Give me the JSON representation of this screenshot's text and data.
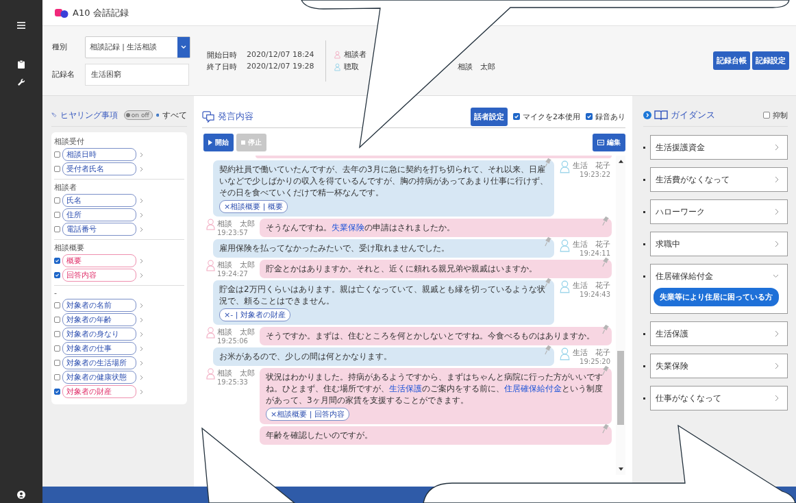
{
  "window": {
    "title": "A10 会話記録"
  },
  "record": {
    "type_label": "種別",
    "type_value": "相談記録 | 生活相談",
    "name_label": "記録名",
    "name_value": "生活困窮"
  },
  "times": [
    {
      "label": "開始日時",
      "value": "2020/12/07 18:24"
    },
    {
      "label": "終了日時",
      "value": "2020/12/07 19:28"
    }
  ],
  "participants": [
    {
      "role": "相談者",
      "kind": "staff"
    },
    {
      "role": "聴取",
      "kind": "client"
    }
  ],
  "participant_name": "相談　太郎",
  "header_buttons": [
    "記録台帳",
    "記録設定"
  ],
  "hearing": {
    "title": "ヒヤリング事項",
    "toggle": {
      "label": "on off",
      "on": false
    },
    "all_label": "すべて",
    "groups": [
      {
        "title": "相談受付",
        "items": [
          {
            "label": "相談日時",
            "checked": false
          },
          {
            "label": "受付者氏名",
            "checked": false
          }
        ]
      },
      {
        "title": "相談者",
        "items": [
          {
            "label": "氏名",
            "checked": false
          },
          {
            "label": "住所",
            "checked": false
          },
          {
            "label": "電話番号",
            "checked": false
          }
        ]
      },
      {
        "title": "相談概要",
        "items": [
          {
            "label": "概要",
            "checked": true
          },
          {
            "label": "回答内容",
            "checked": true
          }
        ]
      },
      {
        "title": "-",
        "items": [
          {
            "label": "対象者の名前",
            "checked": false
          },
          {
            "label": "対象者の年齢",
            "checked": false
          },
          {
            "label": "対象者の身なり",
            "checked": false
          },
          {
            "label": "対象者の仕事",
            "checked": false
          },
          {
            "label": "対象者の生活場所",
            "checked": false
          },
          {
            "label": "対象者の健康状態",
            "checked": false
          },
          {
            "label": "対象者の財産",
            "checked": true
          }
        ]
      }
    ]
  },
  "conversation": {
    "title": "発言内容",
    "speaker_button": "話者設定",
    "options": [
      {
        "label": "マイクを2本使用",
        "checked": true
      },
      {
        "label": "録音あり",
        "checked": true
      }
    ],
    "start": {
      "label": "開始",
      "disabled": false
    },
    "stop": {
      "label": "停止",
      "disabled": true
    },
    "edit": "編集",
    "messages": [
      {
        "kind": "client",
        "name": "生活　花子",
        "time": "19:23:22",
        "segments": [
          {
            "text": "契約社員で働いていたんですが、去年の3月に急に契約を打ち切られて、それ以来、日雇いなどで少しばかりの収入を得ているんですが、胸の持病があってあまり仕事に行けず、その日を食べていくだけで精一杯なんです。",
            "link": false
          }
        ],
        "tags": [
          "×相談概要 | 概要"
        ]
      },
      {
        "kind": "staff",
        "name": "相談　太郎",
        "time": "19:23:57",
        "segments": [
          {
            "text": "そうなんですね。",
            "link": false
          },
          {
            "text": "失業保険",
            "link": true
          },
          {
            "text": "の申請はされましたか。",
            "link": false
          }
        ]
      },
      {
        "kind": "client",
        "name": "生活　花子",
        "time": "19:24:11",
        "segments": [
          {
            "text": "雇用保険を払ってなかったみたいで、受け取れませんでした。",
            "link": false
          }
        ]
      },
      {
        "kind": "staff",
        "name": "相談　太郎",
        "time": "19:24:27",
        "segments": [
          {
            "text": "貯金とかはありますか。それと、近くに頼れる親兄弟や親戚はいますか。",
            "link": false
          }
        ]
      },
      {
        "kind": "client",
        "name": "生活　花子",
        "time": "19:24:43",
        "segments": [
          {
            "text": "貯金は2万円くらいはあります。親は亡くなっていて、親戚とも縁を切っているような状況で、頼ることはできません。",
            "link": false
          }
        ],
        "tags": [
          "×- | 対象者の財産"
        ]
      },
      {
        "kind": "staff",
        "name": "相談　太郎",
        "time": "19:25:06",
        "segments": [
          {
            "text": "そうですか。まずは、住むところを何とかしないとですね。今食べるものはありますか。",
            "link": false
          }
        ]
      },
      {
        "kind": "client",
        "name": "生活　花子",
        "time": "19:25:20",
        "segments": [
          {
            "text": "お米があるので、少しの間は何とかなります。",
            "link": false
          }
        ]
      },
      {
        "kind": "staff",
        "name": "相談　太郎",
        "time": "19:25:33",
        "segments": [
          {
            "text": "状況はわかりました。持病があるようですから、まずはちゃんと病院に行った方がいいですね。ひとまず、住む場所ですが、",
            "link": false
          },
          {
            "text": "生活保護",
            "link": true
          },
          {
            "text": "のご案内をする前に、",
            "link": false
          },
          {
            "text": "住居確保給付金",
            "link": true
          },
          {
            "text": "という制度があって、3ヶ月間の家賃を支援することができます。",
            "link": false
          }
        ],
        "tags": [
          "×相談概要 | 回答内容"
        ]
      },
      {
        "kind": "staff",
        "segments": [
          {
            "text": "年齢を確認したいのですが。",
            "link": false
          }
        ]
      }
    ]
  },
  "guidance": {
    "title": "ガイダンス",
    "suppress": {
      "label": "抑制",
      "checked": false
    },
    "items": [
      {
        "label": "生活援護資金",
        "expanded": false
      },
      {
        "label": "生活費がなくなって",
        "expanded": false
      },
      {
        "label": "ハローワーク",
        "expanded": false
      },
      {
        "label": "求職中",
        "expanded": false
      },
      {
        "label": "住居確保給付金",
        "expanded": true,
        "chips": [
          "失業等により住居に困っている方"
        ]
      },
      {
        "label": "生活保護",
        "expanded": false
      },
      {
        "label": "失業保険",
        "expanded": false
      },
      {
        "label": "仕事がなくなって",
        "expanded": false
      }
    ]
  }
}
